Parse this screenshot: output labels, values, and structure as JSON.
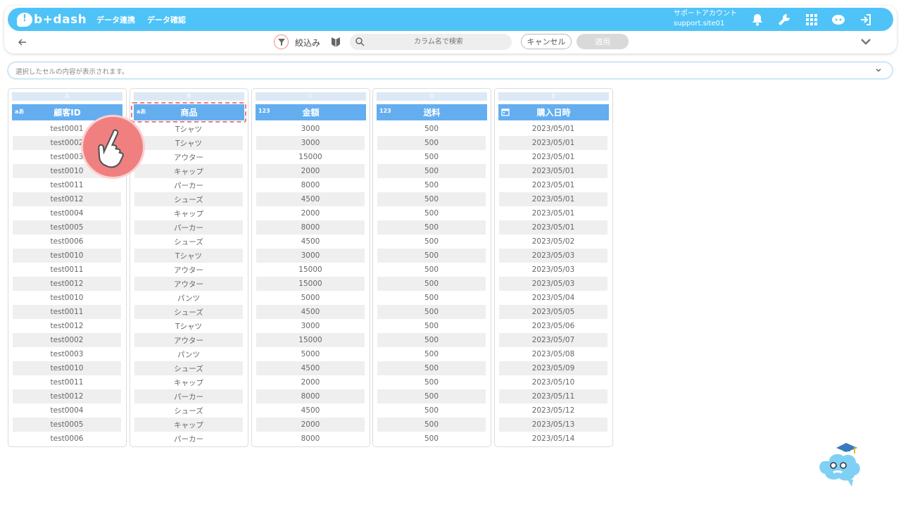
{
  "header": {
    "logo": "b+dash",
    "nav": [
      "データ連携",
      "データ確認"
    ],
    "account_name": "サポートアカウント",
    "account_site": "support.site01",
    "icons": [
      "bell-icon",
      "wrench-icon",
      "grid-icon",
      "chat-icon",
      "logout-icon"
    ]
  },
  "toolbar": {
    "filter_label": "絞込み",
    "search_placeholder": "カラム名で検索",
    "cancel_label": "キャンセル",
    "apply_label": "適用"
  },
  "cell_bar": {
    "placeholder": "選択したセルの内容が表示されます。"
  },
  "columns": [
    {
      "letter": "A",
      "type": "aあ",
      "name": "顧客ID",
      "values": [
        "test0001",
        "test0002",
        "test0003",
        "test0010",
        "test0011",
        "test0012",
        "test0004",
        "test0005",
        "test0006",
        "test0010",
        "test0011",
        "test0012",
        "test0010",
        "test0011",
        "test0012",
        "test0002",
        "test0003",
        "test0010",
        "test0011",
        "test0012",
        "test0004",
        "test0005",
        "test0006"
      ]
    },
    {
      "letter": "B",
      "type": "aあ",
      "name": "商品",
      "values": [
        "Tシャツ",
        "Tシャツ",
        "アウター",
        "キャップ",
        "パーカー",
        "シューズ",
        "キャップ",
        "パーカー",
        "シューズ",
        "Tシャツ",
        "アウター",
        "アウター",
        "パンツ",
        "シューズ",
        "Tシャツ",
        "アウター",
        "パンツ",
        "シューズ",
        "キャップ",
        "パーカー",
        "シューズ",
        "キャップ",
        "パーカー"
      ]
    },
    {
      "letter": "C",
      "type": "123",
      "name": "金額",
      "values": [
        "3000",
        "3000",
        "15000",
        "2000",
        "8000",
        "4500",
        "2000",
        "8000",
        "4500",
        "3000",
        "15000",
        "15000",
        "5000",
        "4500",
        "3000",
        "15000",
        "5000",
        "4500",
        "2000",
        "8000",
        "4500",
        "2000",
        "8000"
      ]
    },
    {
      "letter": "D",
      "type": "123",
      "name": "送料",
      "values": [
        "500",
        "500",
        "500",
        "500",
        "500",
        "500",
        "500",
        "500",
        "500",
        "500",
        "500",
        "500",
        "500",
        "500",
        "500",
        "500",
        "500",
        "500",
        "500",
        "500",
        "500",
        "500",
        "500"
      ]
    },
    {
      "letter": "E",
      "type": "calendar",
      "name": "購入日時",
      "values": [
        "2023/05/01",
        "2023/05/01",
        "2023/05/01",
        "2023/05/01",
        "2023/05/01",
        "2023/05/01",
        "2023/05/01",
        "2023/05/01",
        "2023/05/02",
        "2023/05/03",
        "2023/05/03",
        "2023/05/03",
        "2023/05/04",
        "2023/05/05",
        "2023/05/06",
        "2023/05/07",
        "2023/05/08",
        "2023/05/09",
        "2023/05/10",
        "2023/05/11",
        "2023/05/12",
        "2023/05/13",
        "2023/05/14"
      ]
    }
  ],
  "colors": {
    "header_bg": "#4fc3f7",
    "col_header_bg": "#64aef0",
    "selection": "#f07a7a"
  }
}
